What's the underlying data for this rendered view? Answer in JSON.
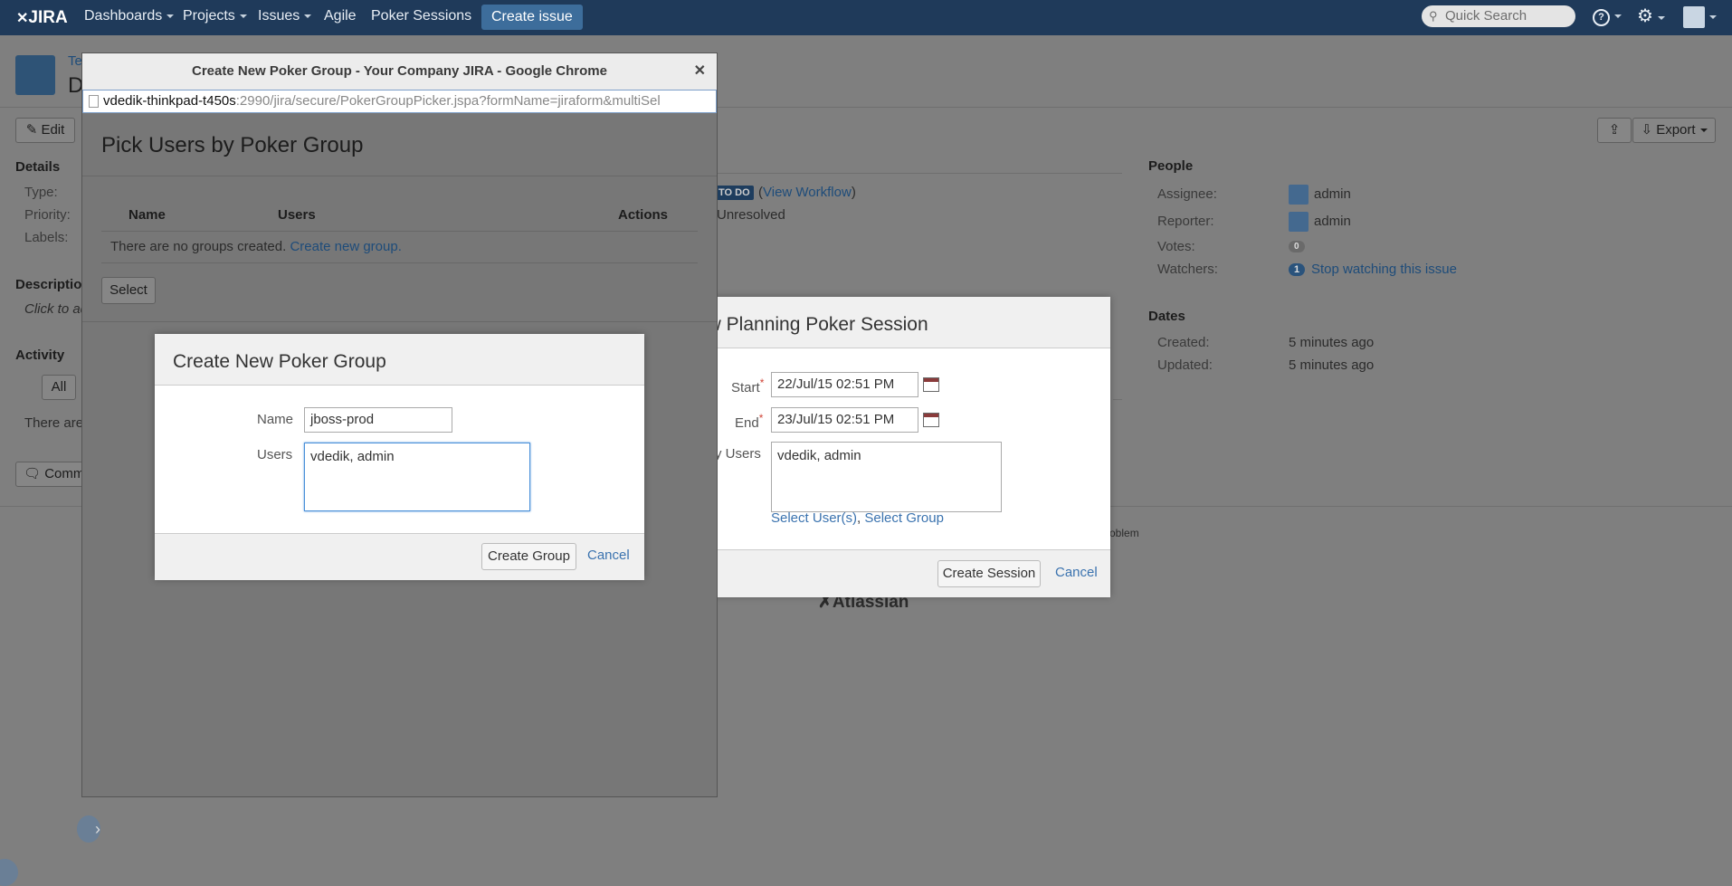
{
  "header": {
    "logo_text": "JIRA",
    "nav": [
      {
        "label": "Dashboards",
        "dropdown": true
      },
      {
        "label": "Projects",
        "dropdown": true
      },
      {
        "label": "Issues",
        "dropdown": true
      },
      {
        "label": "Agile",
        "dropdown": false
      },
      {
        "label": "Poker Sessions",
        "dropdown": false
      }
    ],
    "create_label": "Create issue",
    "search_placeholder": "Quick Search"
  },
  "issue": {
    "project_text": "Te",
    "summary_text": "D",
    "edit_label": "Edit",
    "export_label": "Export",
    "details_heading": "Details",
    "type_label": "Type:",
    "priority_label": "Priority:",
    "labels_label": "Labels:",
    "status_badge": "TO DO",
    "view_workflow": "View Workflow",
    "resolution": "Unresolved",
    "description_heading": "Descriptio",
    "description_placeholder": "Click to ad",
    "activity_heading": "Activity",
    "activity_tab_all": "All",
    "no_comments": "There are",
    "comment_label": "Comm",
    "footer_problem": "oblem",
    "atlassian_logo": "Atlassian"
  },
  "people": {
    "heading": "People",
    "assignee_label": "Assignee:",
    "assignee": "admin",
    "reporter_label": "Reporter:",
    "reporter": "admin",
    "votes_label": "Votes:",
    "votes": "0",
    "watchers_label": "Watchers:",
    "watchers": "1",
    "stop_watching": "Stop watching this issue"
  },
  "dates": {
    "heading": "Dates",
    "created_label": "Created:",
    "created": "5 minutes ago",
    "updated_label": "Updated:",
    "updated": "5 minutes ago"
  },
  "chrome_window": {
    "title": "Create New Poker Group - Your Company JIRA - Google Chrome",
    "url_host": "vdedik-thinkpad-t450s",
    "url_rest": ":2990/jira/secure/PokerGroupPicker.jspa?formName=jiraform&multiSel"
  },
  "picker": {
    "title": "Pick Users by Poker Group",
    "col_name": "Name",
    "col_users": "Users",
    "col_actions": "Actions",
    "empty_text": "There are no groups created.",
    "create_link": "Create new group.",
    "select_label": "Select"
  },
  "group_dialog": {
    "title": "Create New Poker Group",
    "name_label": "Name",
    "name_value": "jboss-prod",
    "users_label": "Users",
    "users_value": "vdedik, admin",
    "create_label": "Create Group",
    "cancel_label": "Cancel"
  },
  "session_dialog": {
    "title": "ew Planning Poker Session",
    "start_label": "Start",
    "start_value": "22/Jul/15 02:51 PM",
    "end_label": "End",
    "end_value": "23/Jul/15 02:51 PM",
    "users_label": "y Users",
    "users_value": "vdedik, admin",
    "select_users": "Select User(s)",
    "select_group": "Select Group",
    "create_label": "Create Session",
    "cancel_label": "Cancel"
  }
}
